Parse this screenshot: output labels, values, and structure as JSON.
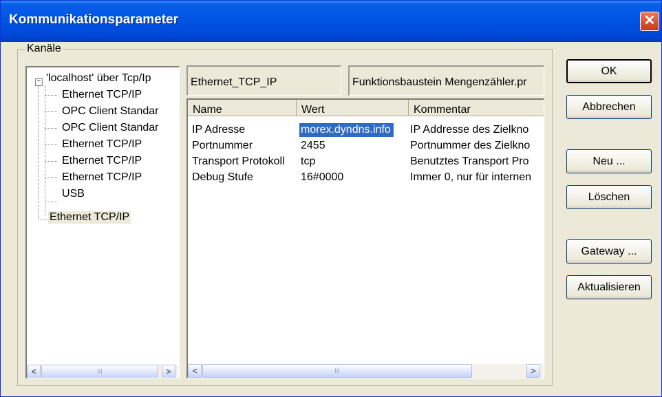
{
  "window": {
    "title": "Kommunikationsparameter",
    "close_glyph": "✕"
  },
  "channels": {
    "group_label": "Kanäle",
    "tree": [
      {
        "label": "'localhost' über Tcp/Ip",
        "level": 0,
        "expanded": true
      },
      {
        "label": "Ethernet TCP/IP",
        "level": 1
      },
      {
        "label": "OPC Client Standar",
        "level": 1
      },
      {
        "label": "OPC Client Standar",
        "level": 1
      },
      {
        "label": "Ethernet TCP/IP",
        "level": 1
      },
      {
        "label": "Ethernet TCP/IP",
        "level": 1
      },
      {
        "label": "Ethernet TCP/IP",
        "level": 1
      },
      {
        "label": "USB",
        "level": 1
      },
      {
        "label": "Ethernet TCP/IP",
        "level": 0,
        "selected": true
      }
    ]
  },
  "channel_name": "Ethernet_TCP_IP",
  "channel_description": "Funktionsbaustein Mengenzähler.pr",
  "parameters": {
    "columns": [
      "Name",
      "Wert",
      "Kommentar"
    ],
    "rows": [
      {
        "name": "IP Adresse",
        "value": "morex.dyndns.info",
        "comment": "IP Addresse des Zielkno",
        "selected": true
      },
      {
        "name": "Portnummer",
        "value": "2455",
        "comment": "Portnummer des Zielkno"
      },
      {
        "name": "Transport Protokoll",
        "value": "tcp",
        "comment": "Benutztes Transport Pro"
      },
      {
        "name": "Debug Stufe",
        "value": "16#0000",
        "comment": "Immer 0, nur für internen"
      }
    ]
  },
  "buttons": {
    "ok": "OK",
    "cancel": "Abbrechen",
    "new": "Neu ...",
    "delete": "Löschen",
    "gateway": "Gateway ...",
    "refresh": "Aktualisieren"
  },
  "scrollbar": {
    "left_arrow": "<",
    "right_arrow": ">",
    "thumb_grip": "III"
  },
  "colors": {
    "titlebar": "#0055e5",
    "selection": "#316ac5",
    "dialog_bg": "#ece9d8"
  }
}
